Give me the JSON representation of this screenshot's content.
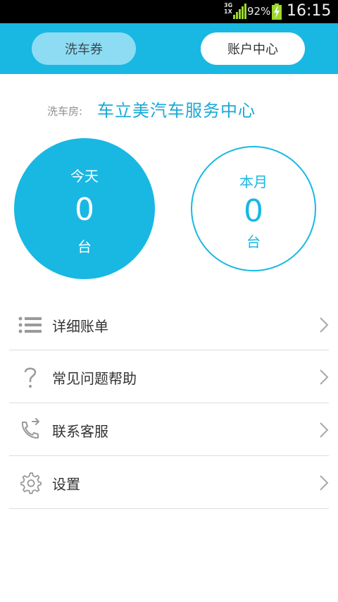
{
  "status_bar": {
    "network_top": "3G",
    "network_bottom": "1X",
    "battery_percent": "92%",
    "time": "16:15",
    "signal_icon": "signal-strength-icon",
    "battery_icon": "battery-charging-icon",
    "signal_color": "#9bd82b",
    "battery_color": "#9bd82b"
  },
  "header": {
    "background": "#18b8e3",
    "tabs": [
      {
        "label": "洗车券",
        "active": false
      },
      {
        "label": "账户中心",
        "active": true
      }
    ]
  },
  "shop": {
    "label": "洗车房:",
    "name": "车立美汽车服务中心"
  },
  "stats": {
    "today": {
      "label": "今天",
      "count": "0",
      "unit": "台"
    },
    "month": {
      "label": "本月",
      "count": "0",
      "unit": "台"
    },
    "accent": "#18b8e3"
  },
  "menu": {
    "items": [
      {
        "label": "详细账单",
        "icon": "list-icon"
      },
      {
        "label": "常见问题帮助",
        "icon": "question-icon"
      },
      {
        "label": "联系客服",
        "icon": "phone-icon"
      },
      {
        "label": "设置",
        "icon": "gear-icon"
      }
    ],
    "chevron_icon": "chevron-right-icon"
  }
}
